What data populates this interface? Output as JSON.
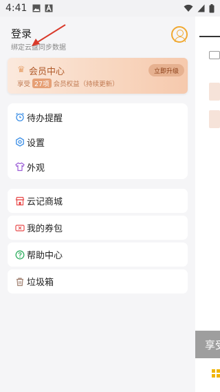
{
  "status_bar": {
    "time": "4:41",
    "left_icons": [
      "image-icon",
      "text-box-icon"
    ],
    "right_icons": [
      "wifi-icon",
      "signal-icon",
      "battery-icon"
    ]
  },
  "drawer": {
    "login_title": "登录",
    "login_subtitle": "绑定云盘同步数据",
    "vip": {
      "title": "会员中心",
      "desc_prefix": "享受",
      "badge": "27项",
      "desc_suffix": "会员权益（持续更新）",
      "button_label": "立即升级"
    },
    "group1": [
      {
        "label": "待办提醒",
        "icon": "alarm-clock-icon"
      },
      {
        "label": "设置",
        "icon": "settings-icon"
      },
      {
        "label": "外观",
        "icon": "shirt-icon"
      }
    ],
    "cards": [
      {
        "label": "云记商城",
        "icon": "shop-icon"
      },
      {
        "label": "我的券包",
        "icon": "coupon-icon"
      },
      {
        "label": "帮助中心",
        "icon": "help-icon"
      },
      {
        "label": "垃圾箱",
        "icon": "trash-icon"
      }
    ]
  },
  "background": {
    "gray_bar_text": "享受"
  },
  "colors": {
    "accent": "#f0a830",
    "vip_text": "#b05a2a",
    "icon_blue": "#3a8ee6",
    "icon_purple": "#9a5bd6",
    "icon_red": "#e84b4b",
    "icon_green": "#2fae5f",
    "icon_gray": "#a08070",
    "annotation_arrow": "#d93a2b"
  }
}
